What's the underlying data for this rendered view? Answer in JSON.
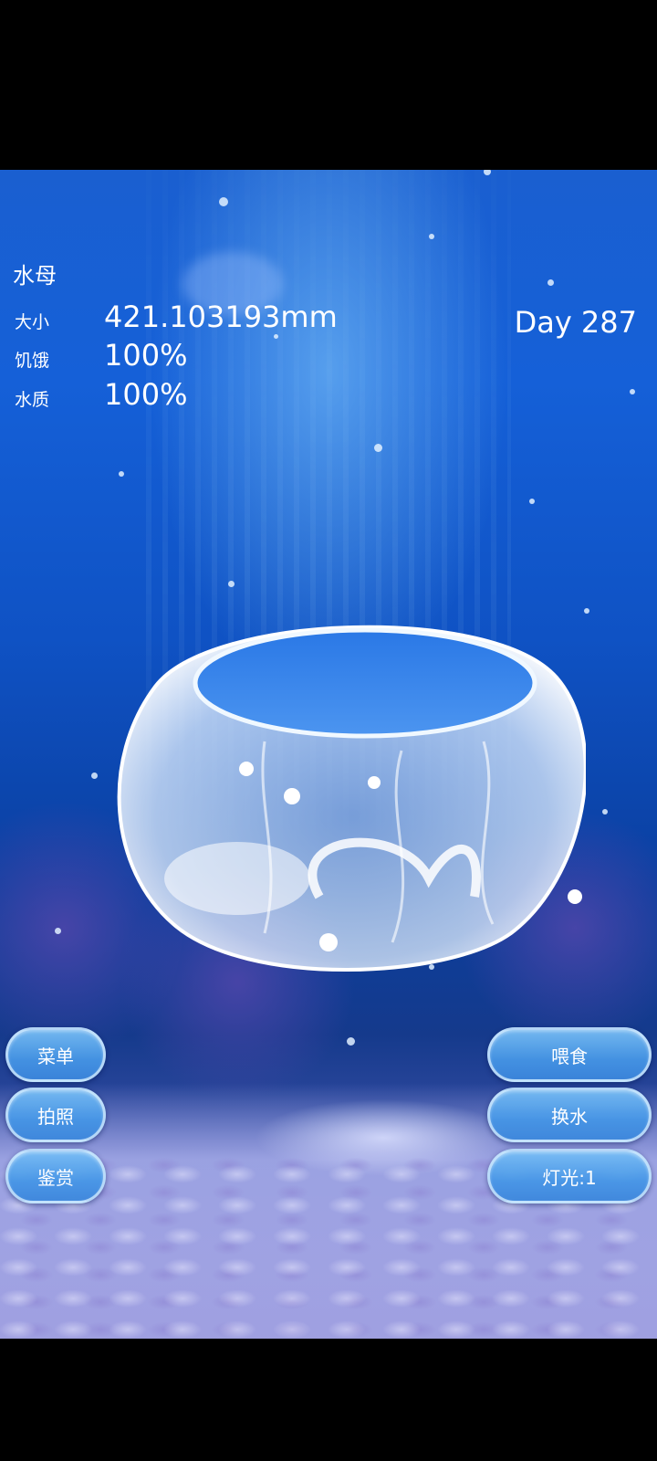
{
  "hud": {
    "species": "水母",
    "size_label": "大小",
    "size_value": "421.103193mm",
    "hunger_label": "饥饿",
    "hunger_value": "100%",
    "water_label": "水质",
    "water_value": "100%",
    "day": "Day 287"
  },
  "buttons": {
    "menu": "菜单",
    "photo": "拍照",
    "gallery": "鉴赏",
    "feed": "喂食",
    "change_water": "换水",
    "light": "灯光:1"
  },
  "colors": {
    "water_top": "#1a5fd0",
    "water_deep": "#0a3e9e",
    "sand": "#a0a0e0",
    "button": "#5a9ee6",
    "text": "#ffffff"
  }
}
